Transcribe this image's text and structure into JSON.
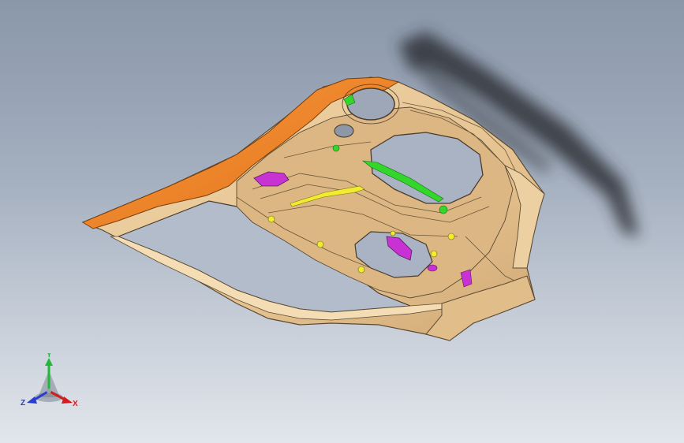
{
  "viewport": {
    "background_top": "#8a97aa",
    "background_bottom": "#e2e6ec"
  },
  "model": {
    "part_color": "#e8c99a",
    "part_edge_color": "#5a4a35",
    "highlight_face_color": "#f07c1e",
    "selected_feature_color_1": "#c832d2",
    "selected_feature_color_2": "#33d62b",
    "selected_feature_color_3": "#f2ec30",
    "shadow_color": "#2a2e35"
  },
  "triad": {
    "y_label": "Y",
    "z_label": "Z",
    "x_label": "X",
    "y_color": "#1fb83a",
    "z_color": "#2a3ccf",
    "x_color": "#d01e1e"
  }
}
